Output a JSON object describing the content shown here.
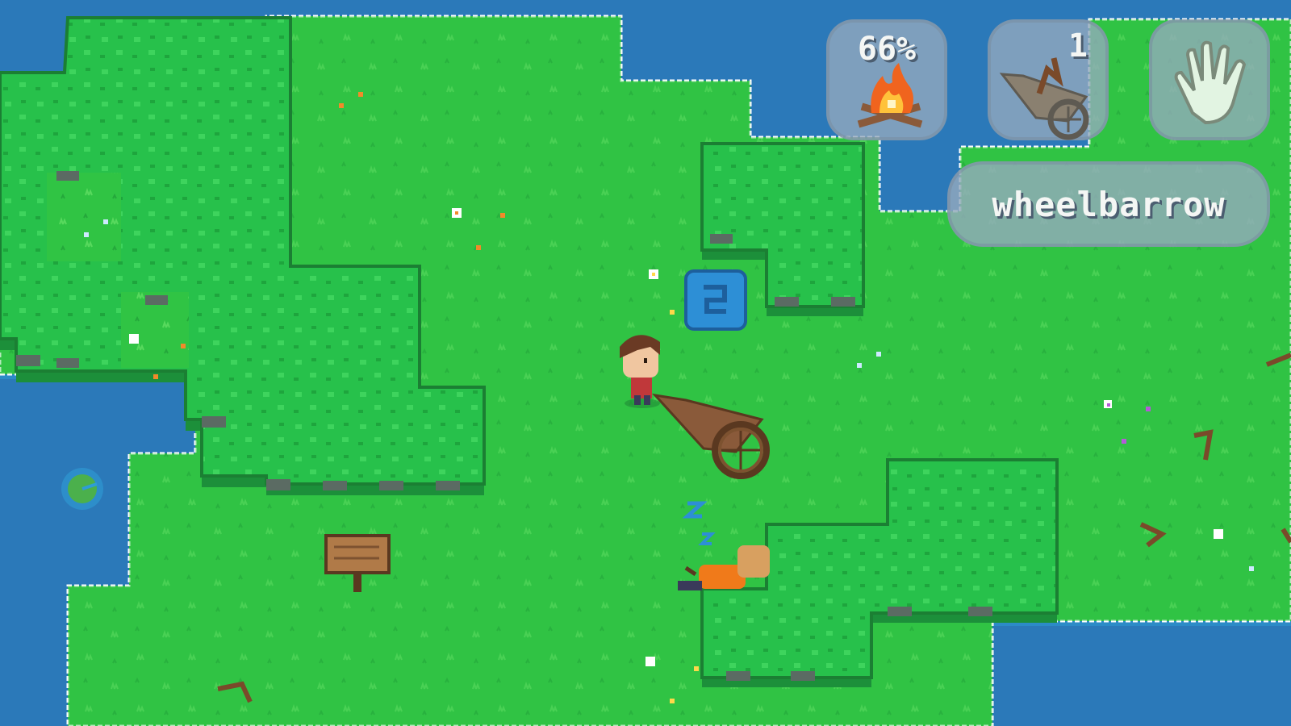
{
  "hud": {
    "fire_percent": "66%",
    "fire_icon": "campfire-icon",
    "wheelbarrow_count": "1",
    "wheelbarrow_icon": "wheelbarrow-icon",
    "hand_icon": "hand-icon"
  },
  "selected_item": {
    "label": "wheelbarrow"
  },
  "colors": {
    "water": "#2b79b9",
    "grass": "#30c444",
    "bush": "#27c14b",
    "hud_panel": "#96aabe",
    "hud_text": "#f4f6f4"
  },
  "entities": {
    "player": "player-character",
    "cart": "wheelbarrow",
    "sleeping_npc": "sleeping-villager",
    "speech_bubble": "question-mark-bubble",
    "sign": "wooden-signpost",
    "lily_pad": "lily-pad"
  }
}
